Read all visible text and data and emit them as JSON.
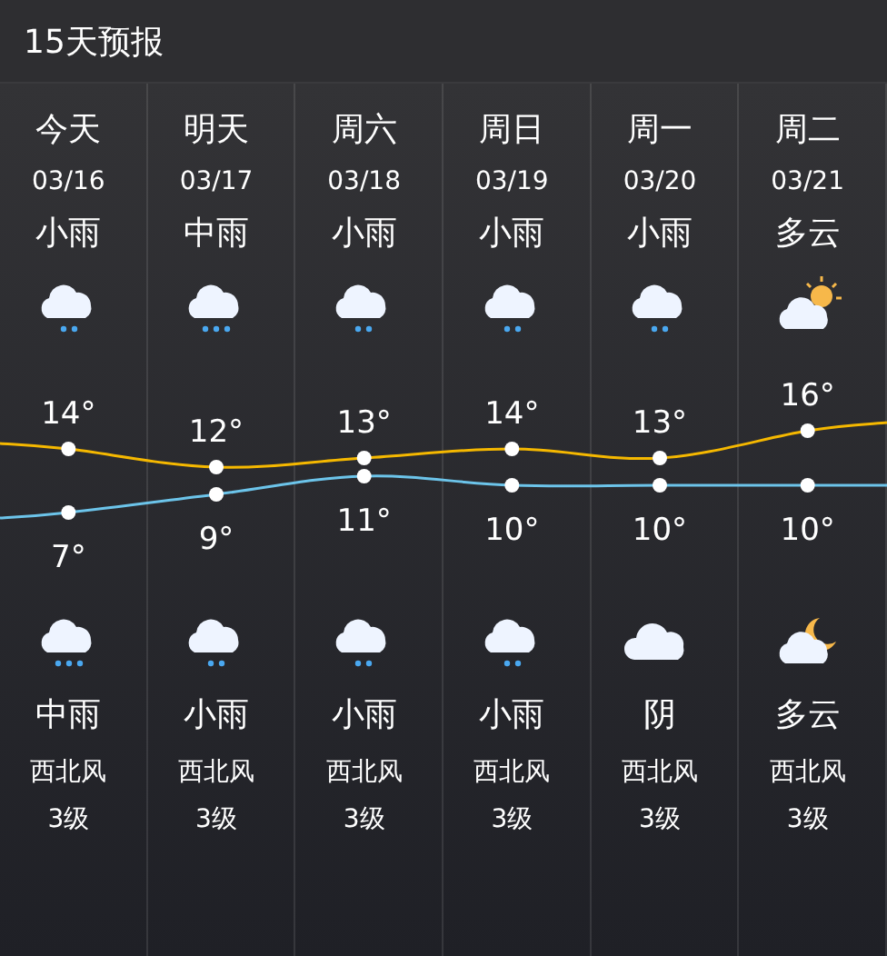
{
  "title": "15天预报",
  "days": [
    {
      "day": "今天",
      "date": "03/16",
      "day_weather": "小雨",
      "day_icon": {
        "kind": "rain-2"
      },
      "night_icon": {
        "kind": "rain-3"
      },
      "night_weather": "中雨",
      "wind": "西北风",
      "wind_level": "3级"
    },
    {
      "day": "明天",
      "date": "03/17",
      "day_weather": "中雨",
      "day_icon": {
        "kind": "rain-3"
      },
      "night_icon": {
        "kind": "rain-2"
      },
      "night_weather": "小雨",
      "wind": "西北风",
      "wind_level": "3级"
    },
    {
      "day": "周六",
      "date": "03/18",
      "day_weather": "小雨",
      "day_icon": {
        "kind": "rain-2"
      },
      "night_icon": {
        "kind": "rain-2"
      },
      "night_weather": "小雨",
      "wind": "西北风",
      "wind_level": "3级"
    },
    {
      "day": "周日",
      "date": "03/19",
      "day_weather": "小雨",
      "day_icon": {
        "kind": "rain-2"
      },
      "night_icon": {
        "kind": "rain-2"
      },
      "night_weather": "小雨",
      "wind": "西北风",
      "wind_level": "3级"
    },
    {
      "day": "周一",
      "date": "03/20",
      "day_weather": "小雨",
      "day_icon": {
        "kind": "rain-2"
      },
      "night_icon": {
        "kind": "cloud"
      },
      "night_weather": "阴",
      "wind": "西北风",
      "wind_level": "3级"
    },
    {
      "day": "周二",
      "date": "03/21",
      "day_weather": "多云",
      "day_icon": {
        "kind": "sun-cloud"
      },
      "night_icon": {
        "kind": "moon-cloud"
      },
      "night_weather": "多云",
      "wind": "西北风",
      "wind_level": "3级"
    }
  ],
  "chart_data": {
    "type": "line",
    "data_labels": true,
    "series": [
      {
        "color": "#f5b800",
        "marker": "circle",
        "values": [
          14,
          12,
          13,
          14,
          13,
          16
        ],
        "value_labels": [
          "14°",
          "12°",
          "13°",
          "14°",
          "13°",
          "16°"
        ]
      },
      {
        "color": "#6cc4ea",
        "marker": "circle",
        "values": [
          7,
          9,
          11,
          10,
          10,
          10
        ],
        "value_labels": [
          "7°",
          "9°",
          "11°",
          "10°",
          "10°",
          "10°"
        ]
      }
    ]
  }
}
